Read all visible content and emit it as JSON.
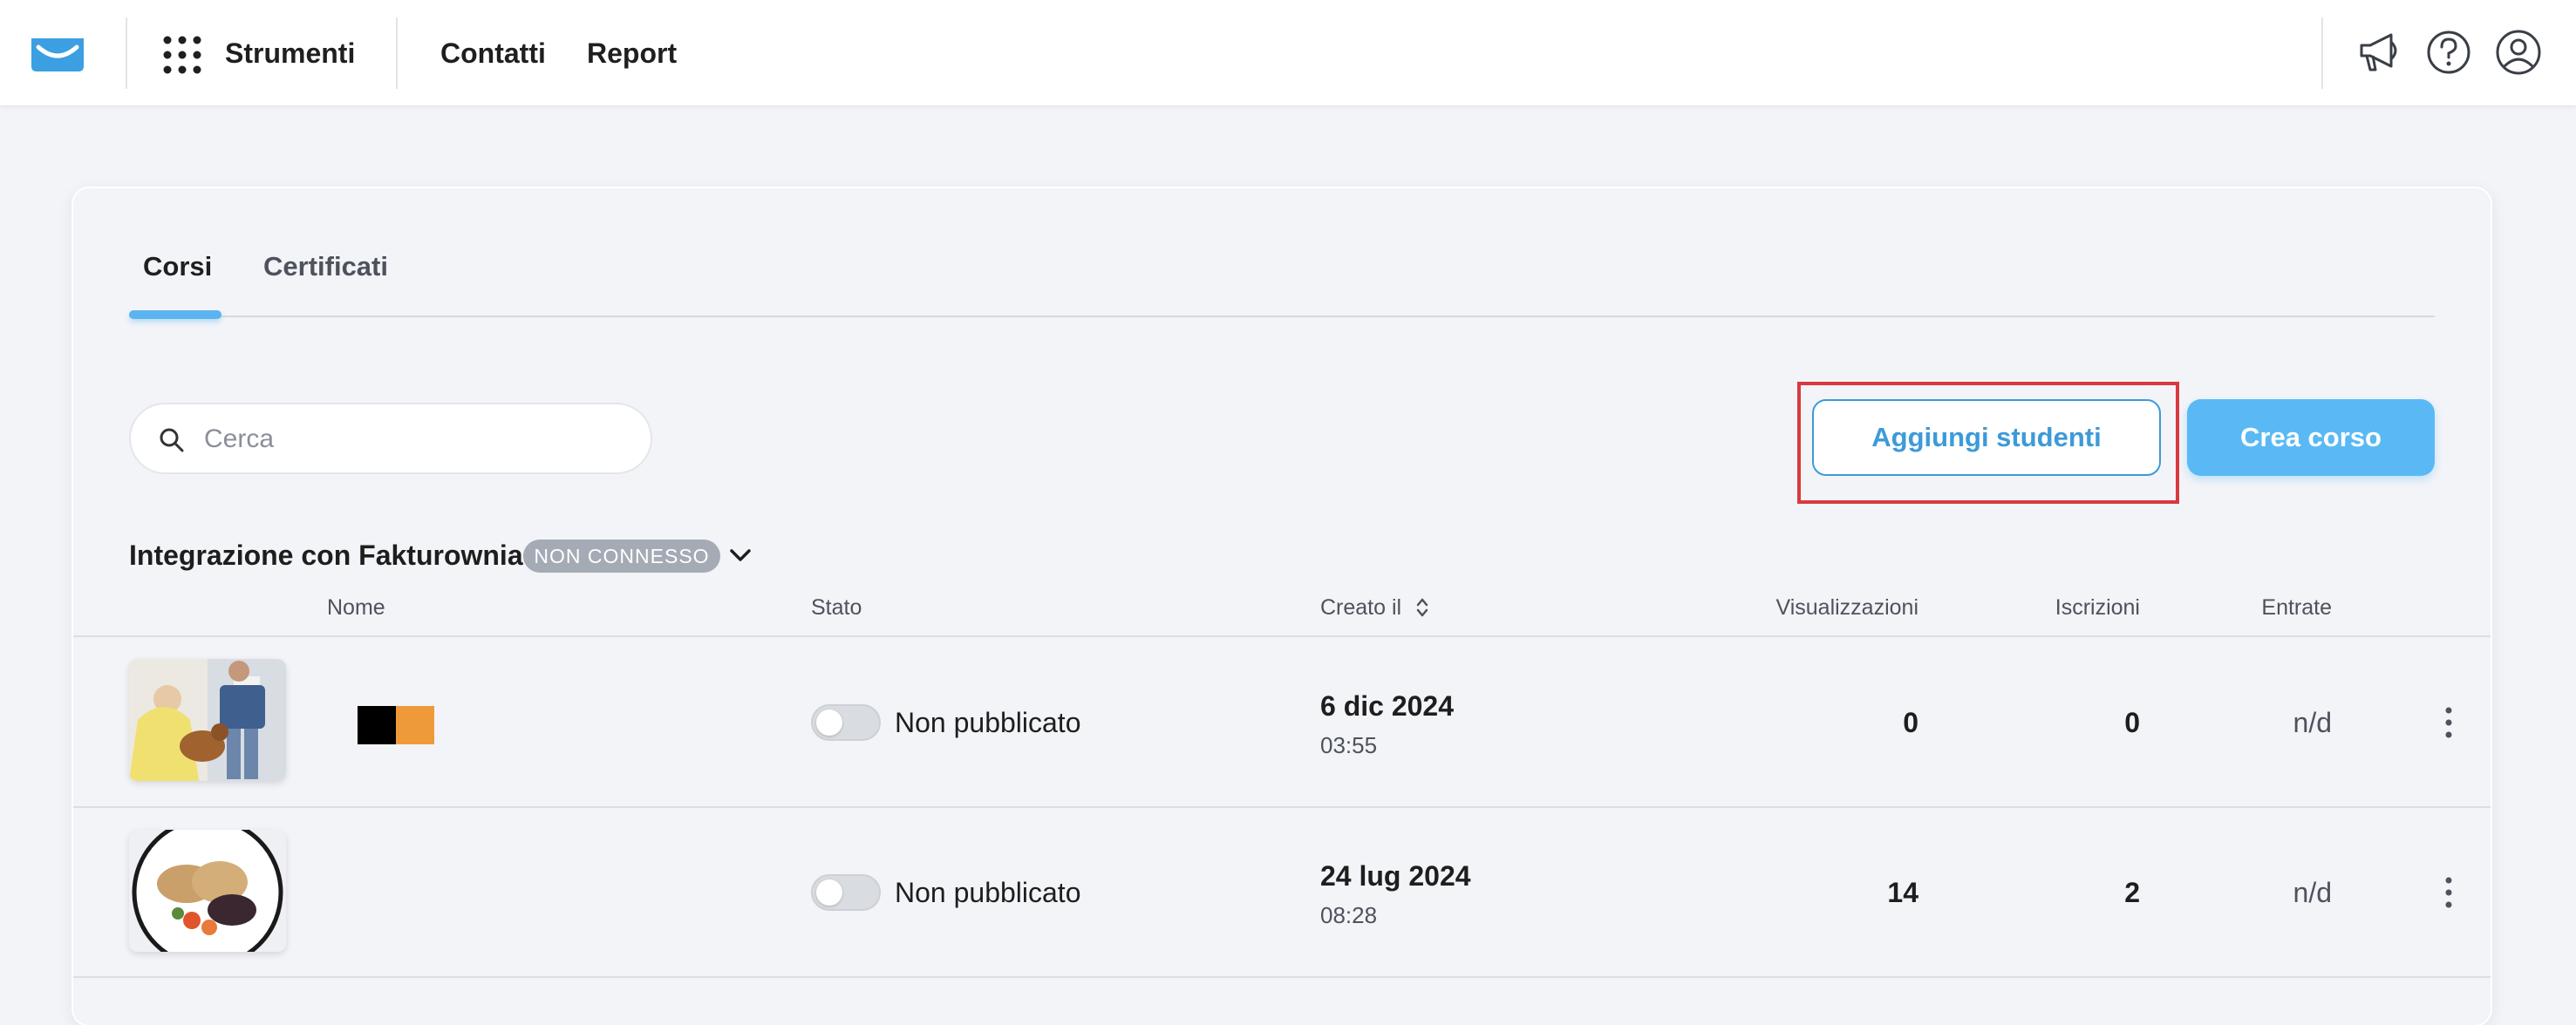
{
  "topbar": {
    "nav": [
      {
        "label": "Strumenti"
      },
      {
        "label": "Contatti"
      },
      {
        "label": "Report"
      }
    ]
  },
  "tabs": [
    {
      "label": "Corsi",
      "active": true
    },
    {
      "label": "Certificati",
      "active": false
    }
  ],
  "search": {
    "placeholder": "Cerca",
    "value": ""
  },
  "actions": {
    "add_students_label": "Aggiungi studenti",
    "create_course_label": "Crea corso"
  },
  "integration": {
    "label": "Integrazione con Fakturownia",
    "status": "NON CONNESSO"
  },
  "table": {
    "headers": {
      "name": "Nome",
      "status": "Stato",
      "created": "Creato il",
      "views": "Visualizzazioni",
      "enrollments": "Iscrizioni",
      "revenue": "Entrate"
    },
    "rows": [
      {
        "status": "Non pubblicato",
        "published": false,
        "date": "6 dic 2024",
        "time": "03:55",
        "views": "0",
        "enrollments": "0",
        "revenue": "n/d"
      },
      {
        "status": "Non pubblicato",
        "published": false,
        "date": "24 lug 2024",
        "time": "08:28",
        "views": "14",
        "enrollments": "2",
        "revenue": "n/d"
      }
    ]
  },
  "colors": {
    "accent": "#5ab9f5",
    "accent_outline": "#3d9ad8",
    "highlight": "#d9393f",
    "badge": "#a4abb5"
  }
}
